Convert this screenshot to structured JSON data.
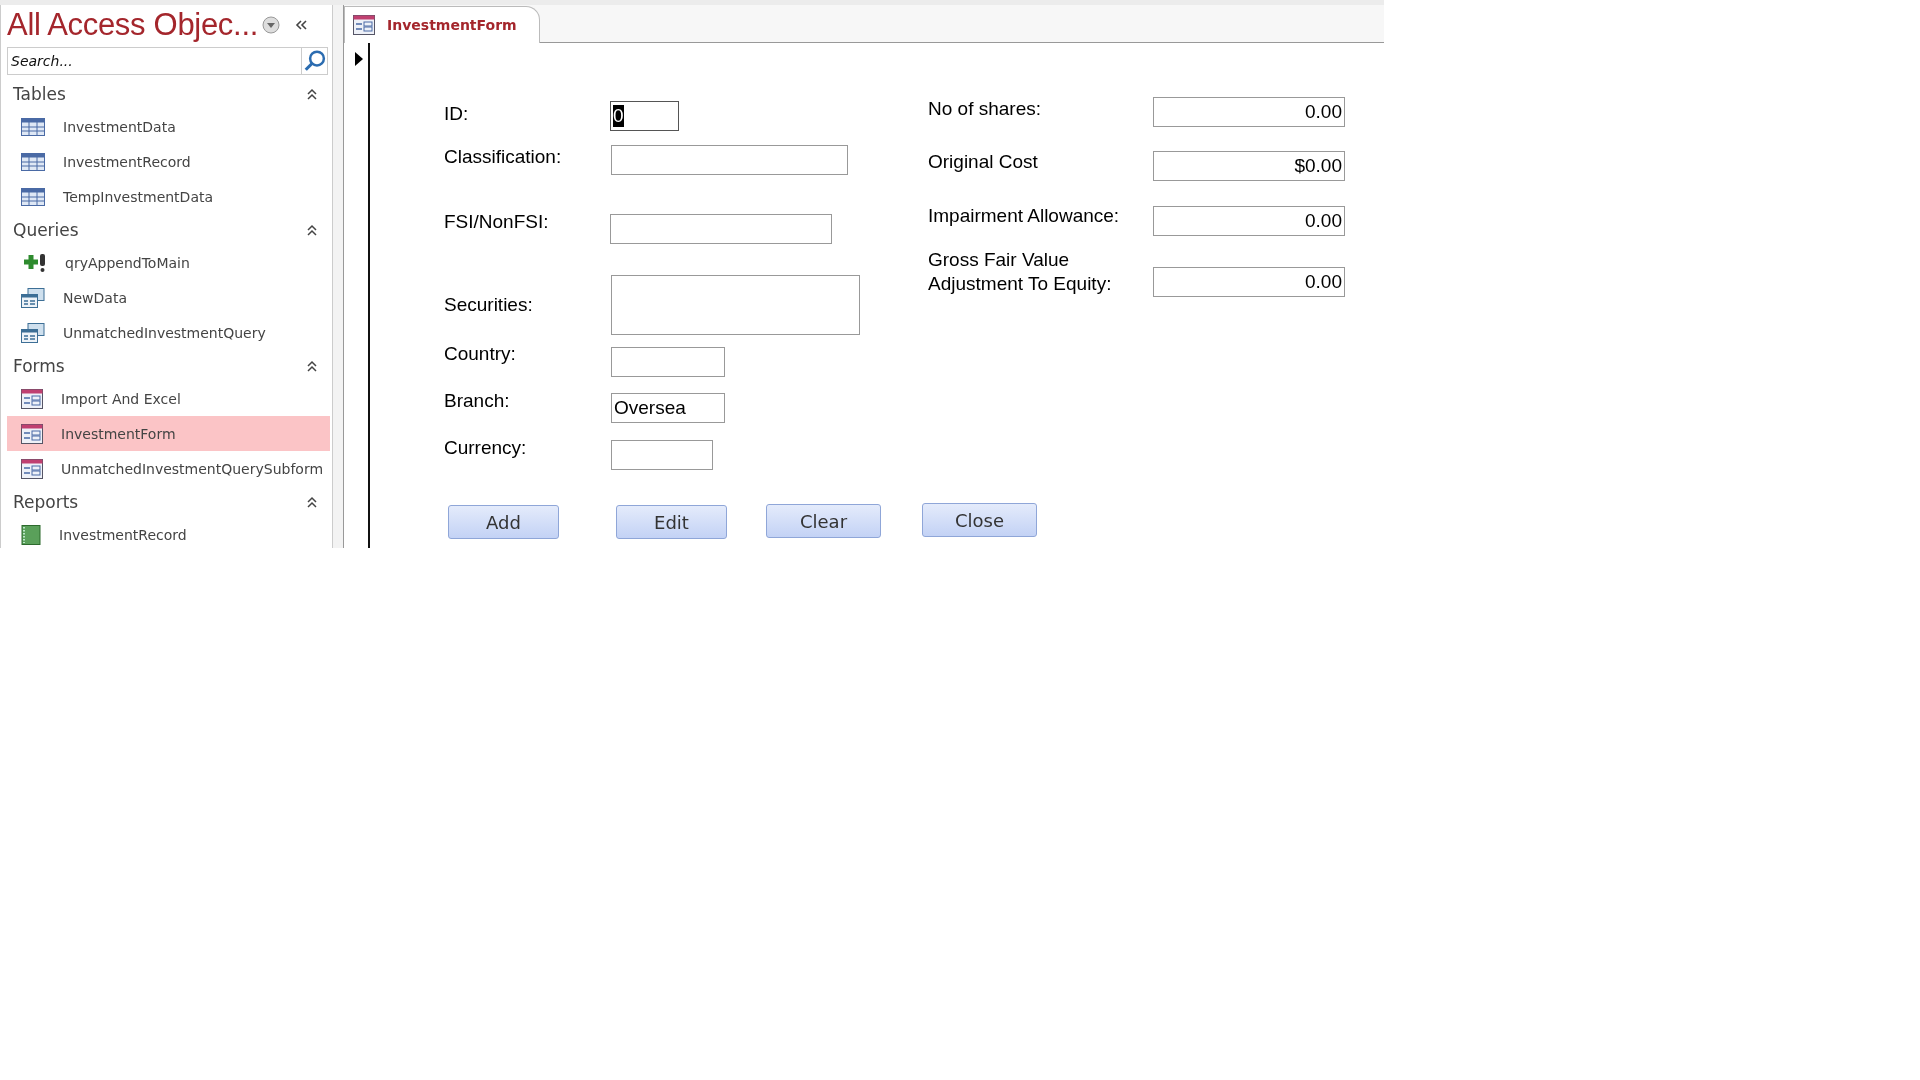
{
  "navigation_pane": {
    "title": "All Access Objec...",
    "search": {
      "placeholder": "Search..."
    },
    "groups": [
      {
        "title": "Tables",
        "expanded": true,
        "items": [
          {
            "label": "InvestmentData",
            "kind": "table",
            "selected": false
          },
          {
            "label": "InvestmentRecord",
            "kind": "table",
            "selected": false
          },
          {
            "label": "TempInvestmentData",
            "kind": "table",
            "selected": false
          }
        ]
      },
      {
        "title": "Queries",
        "expanded": true,
        "items": [
          {
            "label": "qryAppendToMain",
            "kind": "append",
            "selected": false
          },
          {
            "label": "NewData",
            "kind": "query",
            "selected": false
          },
          {
            "label": "UnmatchedInvestmentQuery",
            "kind": "query",
            "selected": false
          }
        ]
      },
      {
        "title": "Forms",
        "expanded": true,
        "items": [
          {
            "label": "Import And Excel",
            "kind": "form",
            "selected": false
          },
          {
            "label": "InvestmentForm",
            "kind": "form",
            "selected": true
          },
          {
            "label": "UnmatchedInvestmentQuerySubform",
            "kind": "form",
            "selected": false
          }
        ]
      },
      {
        "title": "Reports",
        "expanded": true,
        "items": [
          {
            "label": "InvestmentRecord",
            "kind": "report",
            "selected": false
          }
        ]
      }
    ]
  },
  "document_tab": {
    "title": "InvestmentForm"
  },
  "form": {
    "left_fields": [
      {
        "label": "ID:",
        "value": "0",
        "focused": true
      },
      {
        "label": "Classification:",
        "focused": false
      },
      {
        "label": "FSI/NonFSI:",
        "focused": false
      },
      {
        "label": "Securities:",
        "focused": false
      },
      {
        "label": "Country:",
        "focused": false
      },
      {
        "label": "Branch:",
        "value": "Oversea",
        "focused": false
      },
      {
        "label": "Currency:",
        "focused": false
      }
    ],
    "right_fields": [
      {
        "label": "No of shares:",
        "value": "0.00"
      },
      {
        "label": "Original Cost",
        "value": "$0.00"
      },
      {
        "label": "Impairment Allowance:",
        "value": "0.00"
      },
      {
        "label": "Gross Fair Value Adjustment To Equity:",
        "value": "0.00"
      }
    ],
    "buttons": [
      "Add",
      "Edit",
      "Clear",
      "Close"
    ]
  }
}
